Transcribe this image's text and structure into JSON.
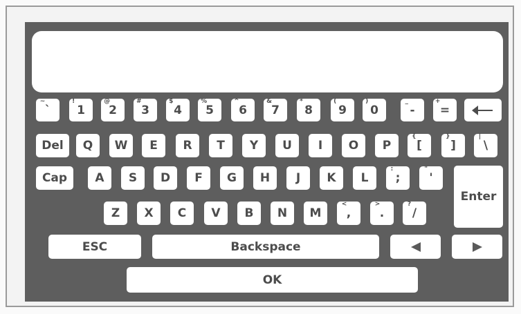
{
  "display": {
    "value": ""
  },
  "row1": [
    {
      "id": "tilde",
      "main": "`",
      "shift": "~"
    },
    {
      "id": "1",
      "main": "1",
      "shift": "!"
    },
    {
      "id": "2",
      "main": "2",
      "shift": "@"
    },
    {
      "id": "3",
      "main": "3",
      "shift": "#"
    },
    {
      "id": "4",
      "main": "4",
      "shift": "$"
    },
    {
      "id": "5",
      "main": "5",
      "shift": "%"
    },
    {
      "id": "6",
      "main": "6",
      "shift": "^"
    },
    {
      "id": "7",
      "main": "7",
      "shift": "&"
    },
    {
      "id": "8",
      "main": "8",
      "shift": "*"
    },
    {
      "id": "9",
      "main": "9",
      "shift": "("
    },
    {
      "id": "0",
      "main": "0",
      "shift": ")"
    },
    {
      "id": "minus",
      "main": "-",
      "shift": "_"
    },
    {
      "id": "equals",
      "main": "=",
      "shift": "+"
    }
  ],
  "row2": [
    {
      "id": "q",
      "main": "Q"
    },
    {
      "id": "w",
      "main": "W"
    },
    {
      "id": "e",
      "main": "E"
    },
    {
      "id": "r",
      "main": "R"
    },
    {
      "id": "t",
      "main": "T"
    },
    {
      "id": "y",
      "main": "Y"
    },
    {
      "id": "u",
      "main": "U"
    },
    {
      "id": "i",
      "main": "I"
    },
    {
      "id": "o",
      "main": "O"
    },
    {
      "id": "p",
      "main": "P"
    },
    {
      "id": "lbracket",
      "main": "[",
      "shift": "{"
    },
    {
      "id": "rbracket",
      "main": "]",
      "shift": "}"
    },
    {
      "id": "backslash",
      "main": "\\",
      "shift": "|"
    }
  ],
  "row3": [
    {
      "id": "a",
      "main": "A"
    },
    {
      "id": "s",
      "main": "S"
    },
    {
      "id": "d",
      "main": "D"
    },
    {
      "id": "f",
      "main": "F"
    },
    {
      "id": "g",
      "main": "G"
    },
    {
      "id": "h",
      "main": "H"
    },
    {
      "id": "j",
      "main": "J"
    },
    {
      "id": "k",
      "main": "K"
    },
    {
      "id": "l",
      "main": "L"
    },
    {
      "id": "semicolon",
      "main": ";",
      "shift": ":"
    },
    {
      "id": "quote",
      "main": "'",
      "shift": "\""
    }
  ],
  "row4": [
    {
      "id": "z",
      "main": "Z"
    },
    {
      "id": "x",
      "main": "X"
    },
    {
      "id": "c",
      "main": "C"
    },
    {
      "id": "v",
      "main": "V"
    },
    {
      "id": "b",
      "main": "B"
    },
    {
      "id": "n",
      "main": "N"
    },
    {
      "id": "m",
      "main": "M"
    },
    {
      "id": "comma",
      "main": ",",
      "shift": "<"
    },
    {
      "id": "period",
      "main": ".",
      "shift": ">"
    },
    {
      "id": "slash",
      "main": "/",
      "shift": "?"
    }
  ],
  "labels": {
    "del": "Del",
    "cap": "Cap",
    "enter": "Enter",
    "esc": "ESC",
    "backspace": "Backspace",
    "ok": "OK"
  },
  "icons": {
    "backspace_arrow": "arrow-left-long-icon",
    "cursor_left": "triangle-left-icon",
    "cursor_right": "triangle-right-icon"
  },
  "colors": {
    "keyboard_bg": "#5e5e5e",
    "key_bg": "#ffffff",
    "key_text": "#4c4c4c"
  }
}
